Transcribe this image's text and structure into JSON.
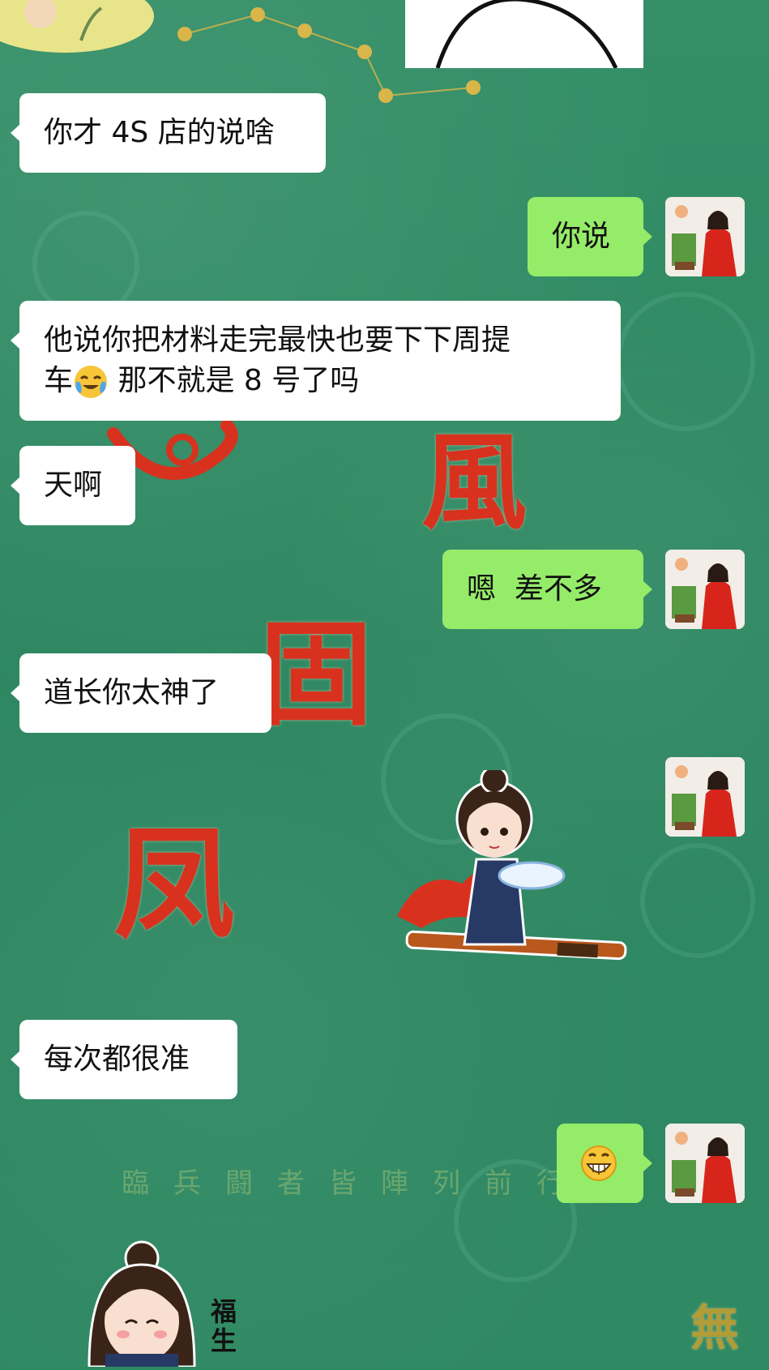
{
  "chat": {
    "messages": [
      {
        "side": "in",
        "text": "你才 4S 店的说啥"
      },
      {
        "side": "out",
        "text": "你说"
      },
      {
        "side": "in",
        "text_line1": "他说你把材料走完最快也要下下周提",
        "text_line2_pre": "车",
        "text_line2_post": " 那不就是 8 号了吗",
        "emoji": "crying-laughing-face"
      },
      {
        "side": "in",
        "text": "天啊"
      },
      {
        "side": "out",
        "text": "嗯  差不多"
      },
      {
        "side": "in",
        "text": "道长你太神了"
      },
      {
        "side": "out",
        "sticker": "taoist-girl-on-sword-sticker"
      },
      {
        "side": "in",
        "text": "每次都很准"
      },
      {
        "side": "out",
        "emoji": "grinning-face"
      }
    ]
  },
  "background": {
    "faded_verse": "臨兵闘者皆陣列前行",
    "seal_glyphs": [
      "風",
      "固",
      "凤"
    ],
    "sticker_name": "福生",
    "corner_glyph": "無"
  },
  "colors": {
    "background": "#2f8a63",
    "incoming_bubble": "#ffffff",
    "outgoing_bubble": "#95ec69",
    "seal_red": "#d8321f"
  }
}
